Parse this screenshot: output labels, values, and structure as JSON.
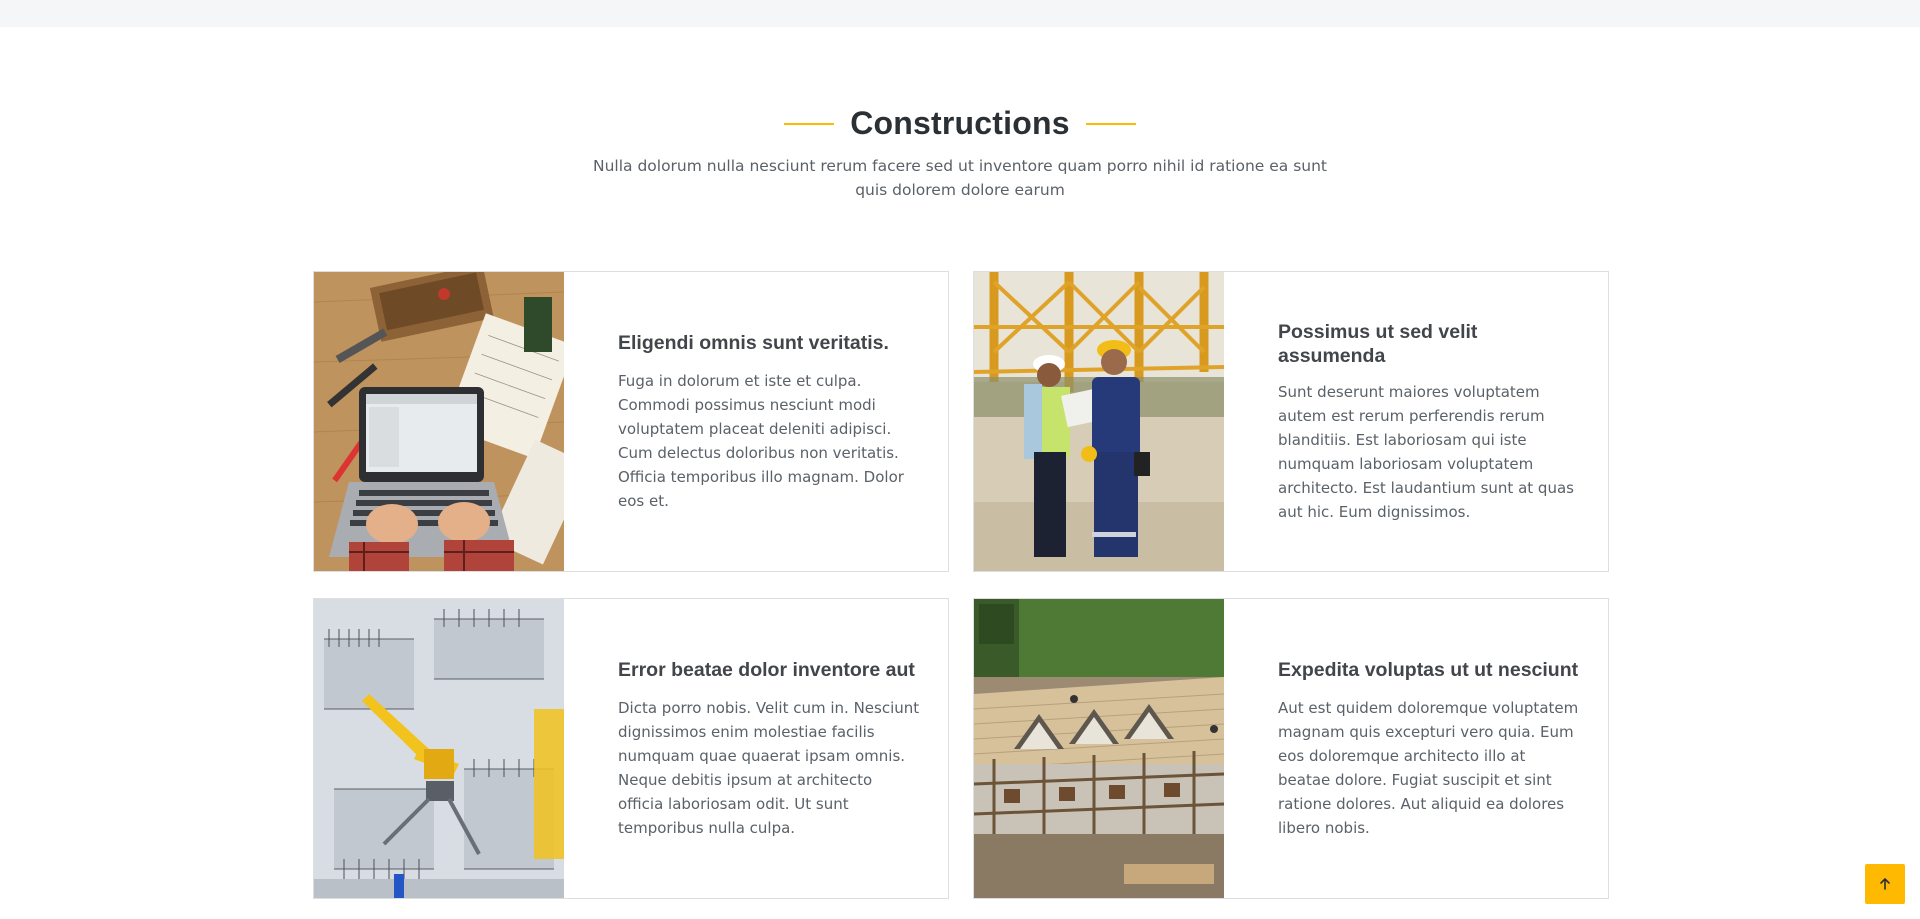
{
  "section": {
    "title": "Constructions",
    "subtitle": "Nulla dolorum nulla nesciunt rerum facere sed ut inventore quam porro nihil id ratione ea sunt quis dolorem dolore earum"
  },
  "cards": [
    {
      "title": "Eligendi omnis sunt veritatis.",
      "text": "Fuga in dolorum et iste et culpa. Commodi possimus nesciunt modi voluptatem placeat deleniti adipisci. Cum delectus doloribus non veritatis. Officia temporibus illo magnam. Dolor eos et.",
      "image": "laptop-with-tools-photo"
    },
    {
      "title": "Possimus ut sed velit assumenda",
      "text": "Sunt deserunt maiores voluptatem autem est rerum perferendis rerum blanditiis. Est laboriosam qui iste numquam laboriosam voluptatem architecto. Est laudantium sunt at quas aut hic. Eum dignissimos.",
      "image": "engineers-on-site-photo"
    },
    {
      "title": "Error beatae dolor inventore aut",
      "text": "Dicta porro nobis. Velit cum in. Nesciunt dignissimos enim molestiae facilis numquam quae quaerat ipsam omnis. Neque debitis ipsum at architecto officia laboriosam odit. Ut sunt temporibus nulla culpa.",
      "image": "aerial-construction-site-photo"
    },
    {
      "title": "Expedita voluptas ut ut nesciunt",
      "text": "Aut est quidem doloremque voluptatem magnam quis excepturi vero quia. Eum eos doloremque architecto illo at beatae dolore. Fugiat suscipit et sint ratione dolores. Aut aliquid ea dolores libero nobis.",
      "image": "house-roof-scaffolding-photo"
    }
  ],
  "colors": {
    "accent": "#feb900",
    "heading": "#2b3035",
    "text": "#5a6168",
    "border": "#dcdfe2"
  },
  "scroll_top": {
    "icon": "arrow-up-icon"
  }
}
